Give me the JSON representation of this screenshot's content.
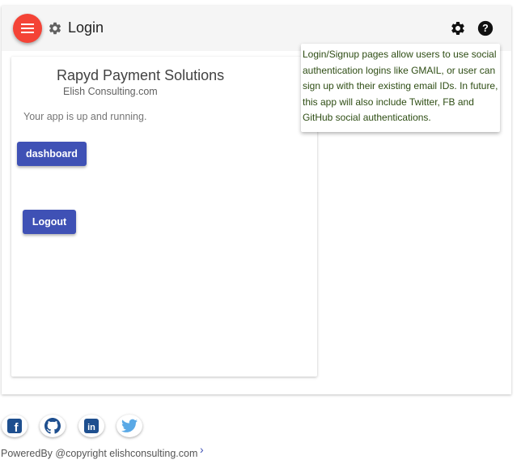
{
  "header": {
    "title": "Login",
    "menu_icon": "hamburger-menu-icon",
    "settings_icon": "gear-icon",
    "help_icon": "help-circle-icon"
  },
  "card": {
    "title": "Rapyd Payment Solutions",
    "subtitle": "Elish Consulting.com",
    "status": "Your app is up and running.",
    "dashboard_label": "dashboard",
    "logout_label": "Logout"
  },
  "tooltip": {
    "text": "Login/Signup pages allow users to use social authentication logins like GMAIL, or user can sign up with their existing email IDs. In future, this app will also include Twitter, FB and GitHub social authentications."
  },
  "footer": {
    "social_icons": [
      "facebook-icon",
      "github-icon",
      "linkedin-icon",
      "twitter-icon"
    ],
    "powered_by": "PoweredBy @copyright elishconsulting.com",
    "chevron": "›"
  },
  "colors": {
    "fab": "#f44336",
    "primary": "#3f51b5",
    "tooltip_text": "#2e4d14",
    "social_blue": "#1e4f8f"
  }
}
